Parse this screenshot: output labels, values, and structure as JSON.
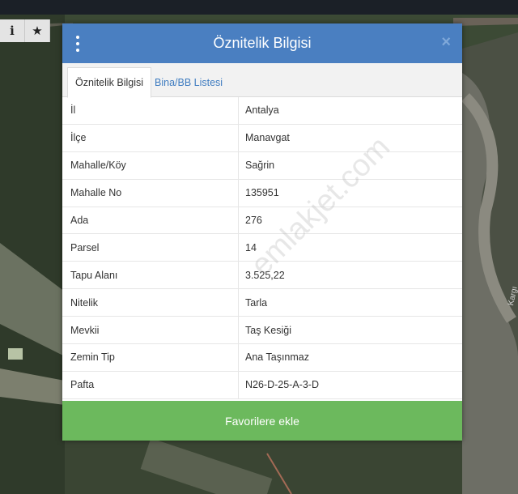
{
  "toolbar": {
    "info_label": "i",
    "star_label": "★"
  },
  "modal": {
    "title": "Öznitelik Bilgisi",
    "close_label": "×",
    "tabs": [
      {
        "label": "Öznitelik Bilgisi",
        "active": true
      },
      {
        "label": "Bina/BB Listesi",
        "active": false
      }
    ],
    "rows": [
      {
        "key": "İl",
        "value": "Antalya"
      },
      {
        "key": "İlçe",
        "value": "Manavgat"
      },
      {
        "key": "Mahalle/Köy",
        "value": "Sağrin"
      },
      {
        "key": "Mahalle No",
        "value": "135951"
      },
      {
        "key": "Ada",
        "value": "276"
      },
      {
        "key": "Parsel",
        "value": "14"
      },
      {
        "key": "Tapu Alanı",
        "value": "3.525,22"
      },
      {
        "key": "Nitelik",
        "value": "Tarla"
      },
      {
        "key": "Mevkii",
        "value": "Taş Kesiği"
      },
      {
        "key": "Zemin Tip",
        "value": "Ana Taşınmaz"
      },
      {
        "key": "Pafta",
        "value": "N26-D-25-A-3-D"
      }
    ],
    "favorite_label": "Favorilere ekle"
  },
  "watermark": "emlakjet.com",
  "map_label": "Kargı",
  "colors": {
    "header": "#4a7fc1",
    "tab_link": "#3f7cc0",
    "favorite_button": "#6cb95d"
  }
}
